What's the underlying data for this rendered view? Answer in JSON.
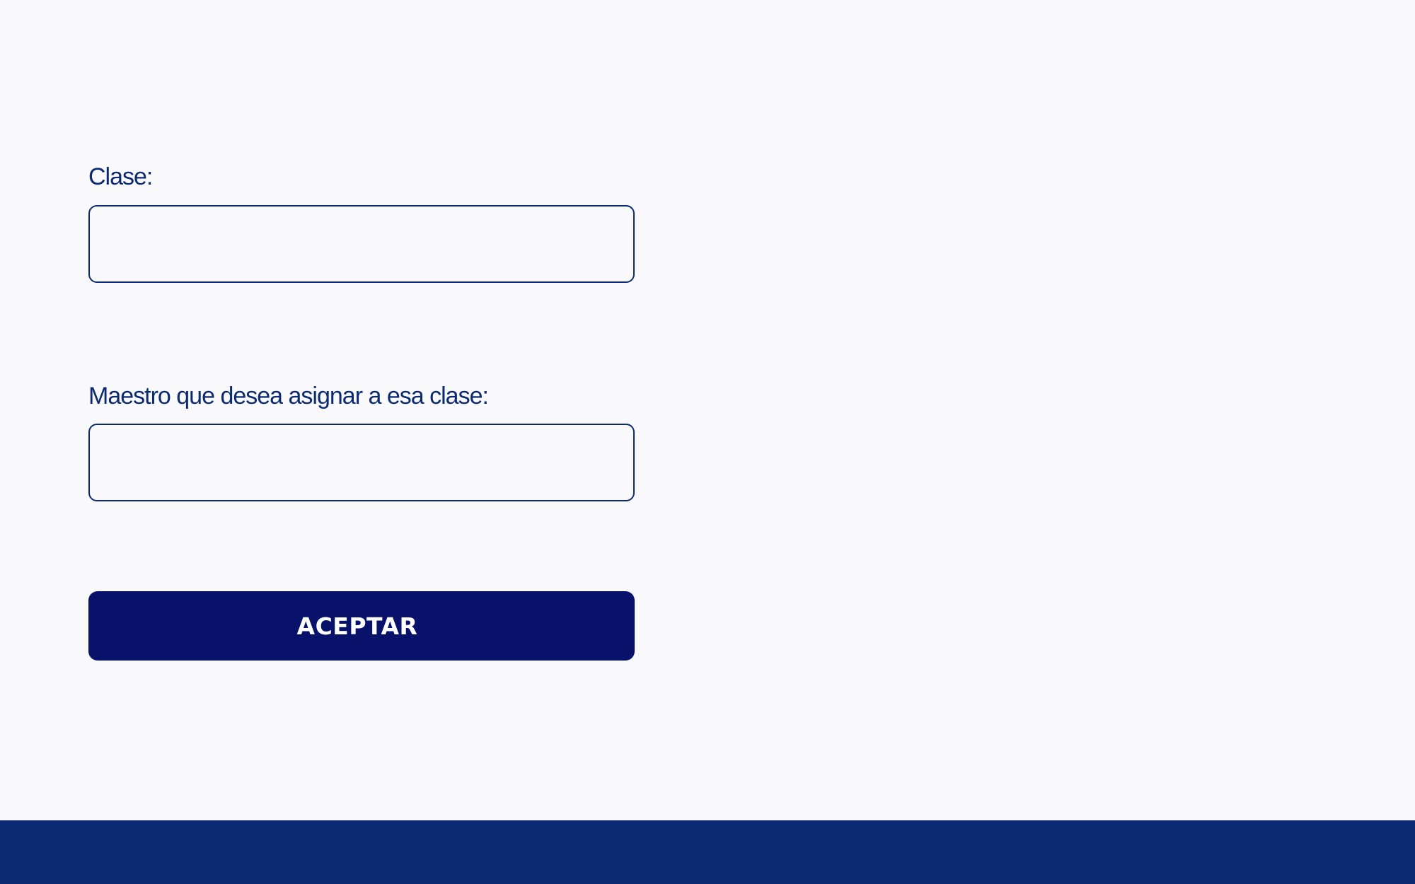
{
  "form": {
    "clase_label": "Clase:",
    "clase_value": "",
    "maestro_label": "Maestro que desea asignar a esa clase:",
    "maestro_value": "",
    "accept_label": "ACEPTAR"
  },
  "colors": {
    "background": "#f9f9fb",
    "label_text": "#0b2a6f",
    "input_border": "#0b2a6f",
    "button_background": "#08126b",
    "button_text": "#ffffff",
    "footer": "#0b2873"
  }
}
